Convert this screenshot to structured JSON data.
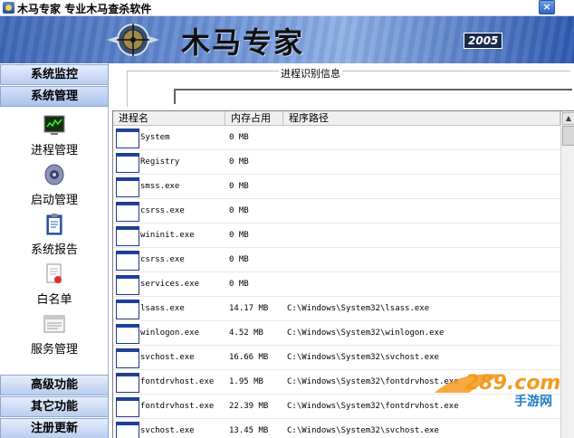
{
  "window": {
    "app_name": "木马专家",
    "subtitle": "专业木马查杀软件",
    "close_label": "×"
  },
  "banner": {
    "title": "木马专家",
    "version_text": "2005"
  },
  "sidebar": {
    "top_sections": [
      {
        "label": "系统监控"
      },
      {
        "label": "系统管理"
      }
    ],
    "items": [
      {
        "label": "进程管理",
        "icon": "process-monitor-icon"
      },
      {
        "label": "启动管理",
        "icon": "startup-speaker-icon"
      },
      {
        "label": "系统报告",
        "icon": "report-clipboard-icon"
      },
      {
        "label": "白名单",
        "icon": "whitelist-doc-icon"
      },
      {
        "label": "服务管理",
        "icon": "service-window-icon"
      }
    ],
    "bottom_sections": [
      {
        "label": "高级功能"
      },
      {
        "label": "其它功能"
      },
      {
        "label": "注册更新"
      }
    ]
  },
  "info": {
    "group_label": "进程识别信息",
    "field_value": ""
  },
  "table": {
    "columns": [
      "进程名",
      "内存占用",
      "程序路径"
    ],
    "rows": [
      {
        "name": "System",
        "memory": "0 MB",
        "path": ""
      },
      {
        "name": "Registry",
        "memory": "0 MB",
        "path": ""
      },
      {
        "name": "smss.exe",
        "memory": "0 MB",
        "path": ""
      },
      {
        "name": "csrss.exe",
        "memory": "0 MB",
        "path": ""
      },
      {
        "name": "wininit.exe",
        "memory": "0 MB",
        "path": ""
      },
      {
        "name": "csrss.exe",
        "memory": "0 MB",
        "path": ""
      },
      {
        "name": "services.exe",
        "memory": "0 MB",
        "path": ""
      },
      {
        "name": "lsass.exe",
        "memory": "14.17 MB",
        "path": "C:\\Windows\\System32\\lsass.exe"
      },
      {
        "name": "winlogon.exe",
        "memory": "4.52 MB",
        "path": "C:\\Windows\\System32\\winlogon.exe"
      },
      {
        "name": "svchost.exe",
        "memory": "16.66 MB",
        "path": "C:\\Windows\\System32\\svchost.exe"
      },
      {
        "name": "fontdrvhost.exe",
        "memory": "1.95 MB",
        "path": "C:\\Windows\\System32\\fontdrvhost.exe"
      },
      {
        "name": "fontdrvhost.exe",
        "memory": "22.39 MB",
        "path": "C:\\Windows\\System32\\fontdrvhost.exe"
      },
      {
        "name": "svchost.exe",
        "memory": "13.45 MB",
        "path": "C:\\Windows\\System32\\svchost.exe"
      }
    ]
  },
  "watermark": {
    "text": "289.com",
    "subtext": "手游网"
  },
  "colors": {
    "banner_blue": "#3f68b8",
    "sidebar_header": "#b9cdee",
    "watermark_orange": "#f39a1e"
  }
}
